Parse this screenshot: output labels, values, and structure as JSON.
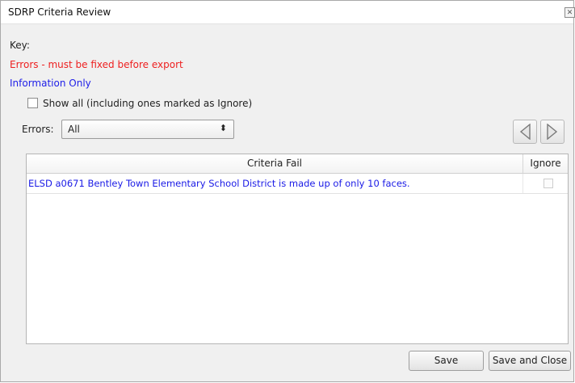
{
  "window": {
    "title": "SDRP Criteria Review",
    "close_icon": "close-icon"
  },
  "key": {
    "label": "Key:",
    "error_text": "Errors - must be fixed before export",
    "error_color": "#ee2020",
    "info_text": "Information Only",
    "info_color": "#2020e8"
  },
  "show_all": {
    "label": "Show all (including ones marked as Ignore)",
    "checked": false
  },
  "errors_filter": {
    "label": "Errors:",
    "selected": "All"
  },
  "navigation": {
    "prev_icon": "triangle-left-icon",
    "next_icon": "triangle-right-icon"
  },
  "table": {
    "columns": [
      "Criteria Fail",
      "Ignore"
    ],
    "rows": [
      {
        "criteria": "ELSD a0671 Bentley Town Elementary School District is made up of only 10 faces.",
        "ignore": false
      }
    ]
  },
  "buttons": {
    "save": "Save",
    "save_and_close": "Save and Close"
  }
}
